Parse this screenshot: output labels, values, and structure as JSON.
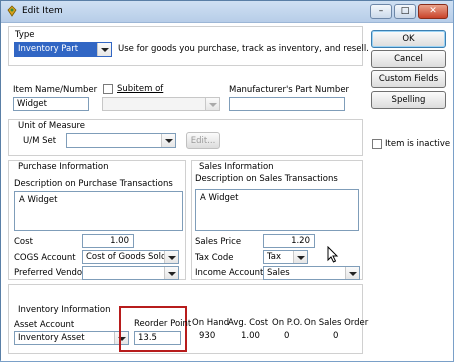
{
  "window": {
    "title": "Edit Item"
  },
  "type_section": {
    "label": "Type",
    "value": "Inventory Part",
    "description": "Use for goods you purchase, track as inventory, and resell."
  },
  "item_name": {
    "label": "Item Name/Number",
    "value": "Widget"
  },
  "subitem": {
    "label": "Subitem of",
    "value": ""
  },
  "mfr_part": {
    "label": "Manufacturer's Part Number",
    "value": ""
  },
  "unit_of_measure": {
    "label": "Unit of Measure",
    "um_set_label": "U/M Set",
    "um_set_value": "",
    "edit_label": "Edit..."
  },
  "purchase": {
    "header": "Purchase Information",
    "desc_label": "Description on Purchase Transactions",
    "desc_value": "A Widget",
    "cost_label": "Cost",
    "cost_value": "1.00",
    "cogs_label": "COGS Account",
    "cogs_value": "Cost of Goods Sold",
    "vendor_label": "Preferred Vendor",
    "vendor_value": ""
  },
  "sales": {
    "header": "Sales Information",
    "desc_label": "Description on Sales Transactions",
    "desc_value": "A Widget",
    "price_label": "Sales Price",
    "price_value": "1.20",
    "tax_label": "Tax Code",
    "tax_value": "Tax",
    "income_label": "Income Account",
    "income_value": "Sales"
  },
  "inventory": {
    "header": "Inventory Information",
    "asset_label": "Asset Account",
    "asset_value": "Inventory Asset",
    "reorder_label": "Reorder Point",
    "reorder_value": "13.5",
    "on_hand_label": "On Hand",
    "on_hand_value": "930",
    "avg_cost_label": "Avg. Cost",
    "avg_cost_value": "1.00",
    "on_po_label": "On P.O.",
    "on_po_value": "0",
    "on_so_label": "On Sales Order",
    "on_so_value": "0"
  },
  "buttons": {
    "ok": "OK",
    "cancel": "Cancel",
    "custom_fields": "Custom Fields",
    "spelling": "Spelling"
  },
  "inactive": {
    "label": "Item is inactive"
  },
  "icons": {
    "app": "quickbooks-app-icon",
    "minimize": "minimize-icon",
    "maximize": "maximize-icon",
    "close": "close-icon",
    "cursor": "mouse-pointer-icon"
  },
  "colors": {
    "highlight": "#b71c1c",
    "accent": "#3c7fb1"
  }
}
